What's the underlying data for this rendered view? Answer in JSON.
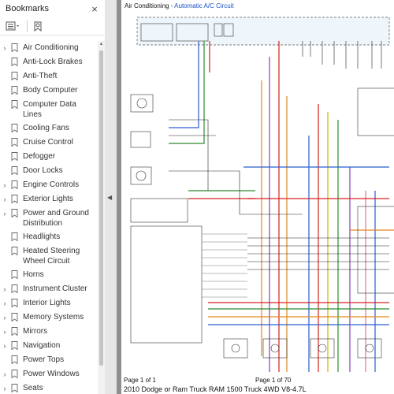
{
  "sidebar": {
    "title": "Bookmarks",
    "close_symbol": "×",
    "items": [
      {
        "label": "Air Conditioning",
        "expandable": true
      },
      {
        "label": "Anti-Lock Brakes",
        "expandable": false
      },
      {
        "label": "Anti-Theft",
        "expandable": false
      },
      {
        "label": "Body Computer",
        "expandable": false
      },
      {
        "label": "Computer Data Lines",
        "expandable": false
      },
      {
        "label": "Cooling Fans",
        "expandable": false
      },
      {
        "label": "Cruise Control",
        "expandable": false
      },
      {
        "label": "Defogger",
        "expandable": false
      },
      {
        "label": "Door Locks",
        "expandable": false
      },
      {
        "label": "Engine Controls",
        "expandable": true
      },
      {
        "label": "Exterior Lights",
        "expandable": true
      },
      {
        "label": "Power and Ground Distribution",
        "expandable": true
      },
      {
        "label": "Headlights",
        "expandable": false
      },
      {
        "label": "Heated Steering Wheel Circuit",
        "expandable": false
      },
      {
        "label": "Horns",
        "expandable": false
      },
      {
        "label": "Instrument Cluster",
        "expandable": true
      },
      {
        "label": "Interior Lights",
        "expandable": true
      },
      {
        "label": "Memory Systems",
        "expandable": true
      },
      {
        "label": "Mirrors",
        "expandable": true
      },
      {
        "label": "Navigation",
        "expandable": true
      },
      {
        "label": "Power Tops",
        "expandable": false
      },
      {
        "label": "Power Windows",
        "expandable": true
      },
      {
        "label": "Seats",
        "expandable": true
      }
    ]
  },
  "document": {
    "header_prefix": "Air Conditioning - ",
    "header_link": "Automatic A/C Circuit",
    "footer_page_left": "Page 1 of 1",
    "footer_page_center": "Page 1 of 70",
    "footer_title": "2010 Dodge or Ram Truck RAM 1500 Truck 4WD V8-4.7L"
  },
  "colors": {
    "link": "#1a52c8",
    "wire_green": "#2e8b2e",
    "wire_red": "#d82020",
    "wire_blue": "#2a5fd0",
    "wire_orange": "#e08a1e",
    "wire_violet": "#8a3fb0",
    "wire_yellow": "#d4b200",
    "wire_pink": "#e070b0"
  }
}
